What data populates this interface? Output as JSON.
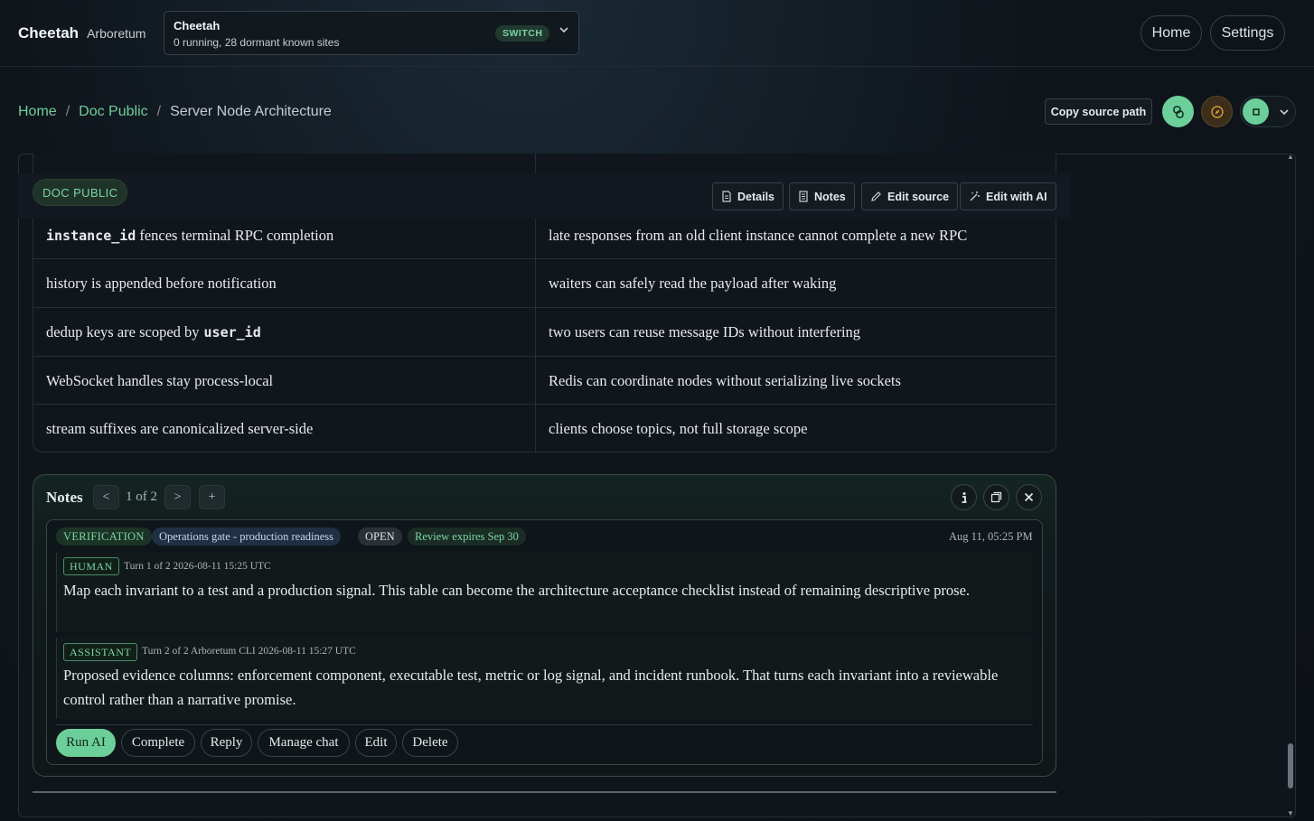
{
  "header": {
    "brand": "Cheetah",
    "brand_sub": "Arboretum",
    "site_name": "Cheetah",
    "site_status": "0 running, 28 dormant known sites",
    "switch_label": "SWITCH",
    "nav": [
      "Home",
      "Settings"
    ]
  },
  "breadcrumb": {
    "items": [
      "Home",
      "Doc Public"
    ],
    "current": "Server Node Architecture",
    "separator": "/"
  },
  "page_actions": {
    "copy_source_path": "Copy source path"
  },
  "doc_toolbar": {
    "badge": "DOC PUBLIC",
    "buttons": [
      "Details",
      "Notes",
      "Edit source",
      "Edit with AI"
    ]
  },
  "table": {
    "rows": [
      {
        "c1_code": "instance_id",
        "c1_text": "fences terminal RPC completion",
        "c2": "late responses from an old client instance cannot complete a new RPC"
      },
      {
        "c1_text": "history is appended before notification",
        "c2": "waiters can safely read the payload after waking"
      },
      {
        "c1_text": "dedup keys are scoped by",
        "c1_code_after": "user_id",
        "c2": "two users can reuse message IDs without interfering"
      },
      {
        "c1_text": "WebSocket handles stay process-local",
        "c2": "Redis can coordinate nodes without serializing live sockets"
      },
      {
        "c1_text": "stream suffixes are canonicalized server-side",
        "c2": "clients choose topics, not full storage scope"
      }
    ]
  },
  "notes": {
    "title": "Notes",
    "prev": "<",
    "next": ">",
    "add": "+",
    "pager": "1 of 2",
    "note": {
      "tags": [
        "VERIFICATION",
        "Operations gate - production readiness",
        "OPEN",
        "Review expires Sep 30"
      ],
      "date": "Aug 11, 05:25 PM",
      "turns": [
        {
          "role": "HUMAN",
          "meta": "Turn 1 of 2  2026-08-11 15:25 UTC",
          "text": "Map each invariant to a test and a production signal. This table can become the architecture acceptance checklist instead of remaining descriptive prose."
        },
        {
          "role": "ASSISTANT",
          "meta": "Turn 2 of 2  Arboretum CLI  2026-08-11 15:27 UTC",
          "text": "Proposed evidence columns: enforcement component, executable test, metric or log signal, and incident runbook. That turns each invariant into a reviewable control rather than a narrative promise."
        }
      ],
      "actions": [
        "Run AI",
        "Complete",
        "Reply",
        "Manage chat",
        "Edit",
        "Delete"
      ]
    }
  },
  "colors": {
    "accent": "#6ccf9a",
    "background": "#0f151b",
    "border": "#262f37"
  }
}
